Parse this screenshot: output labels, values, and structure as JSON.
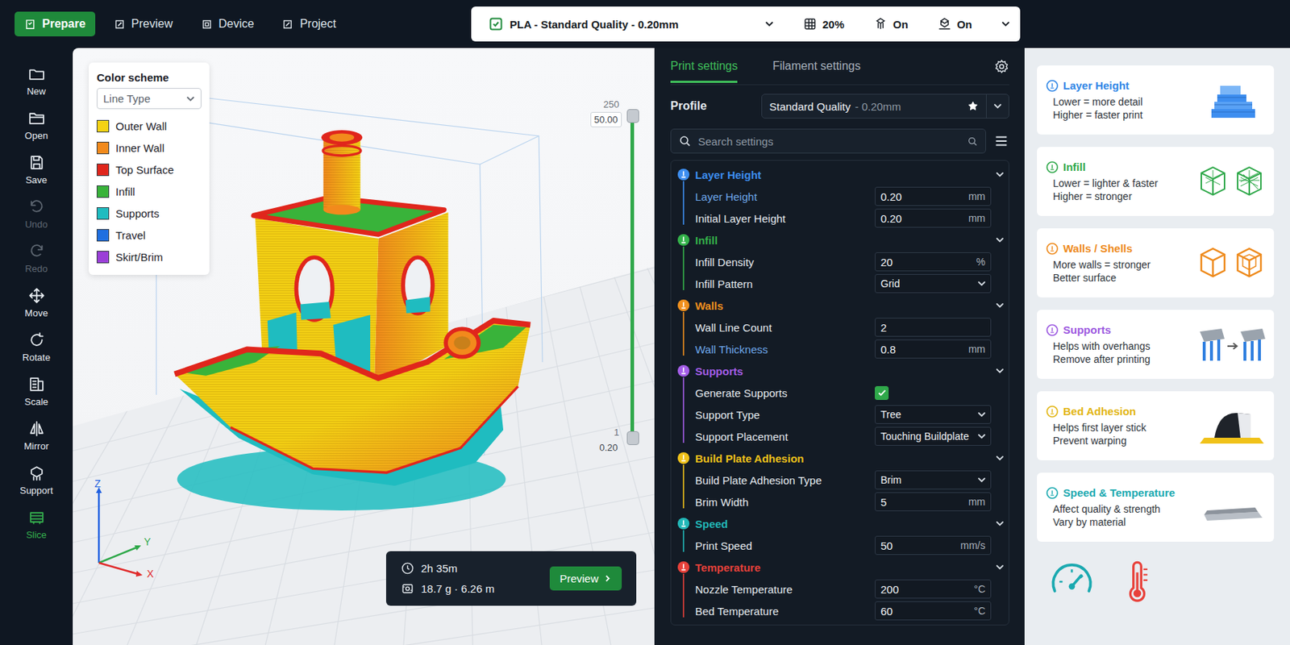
{
  "top_bar": {
    "tabs": [
      {
        "label": "Prepare",
        "selected": true
      },
      {
        "label": "Preview",
        "selected": false
      },
      {
        "label": "Device",
        "selected": false
      },
      {
        "label": "Project",
        "selected": false
      }
    ],
    "summary": {
      "profile": "PLA - Standard Quality - 0.20mm",
      "infill": "20%",
      "supports": "On",
      "adhesion": "On"
    }
  },
  "toolbar": [
    {
      "label": "New",
      "disabled": false,
      "selected": false
    },
    {
      "label": "Open",
      "disabled": false,
      "selected": false
    },
    {
      "label": "Save",
      "disabled": false,
      "selected": false
    },
    {
      "label": "Undo",
      "disabled": true,
      "selected": false
    },
    {
      "label": "Redo",
      "disabled": true,
      "selected": false
    },
    {
      "label": "Move",
      "disabled": false,
      "selected": false
    },
    {
      "label": "Rotate",
      "disabled": false,
      "selected": false
    },
    {
      "label": "Scale",
      "disabled": false,
      "selected": false
    },
    {
      "label": "Mirror",
      "disabled": false,
      "selected": false
    },
    {
      "label": "Support",
      "disabled": false,
      "selected": false
    },
    {
      "label": "Slice",
      "disabled": false,
      "selected": true
    }
  ],
  "viewport": {
    "legend": {
      "title": "Color scheme",
      "select": "Line Type",
      "items": [
        {
          "label": "Outer Wall",
          "color": "#f5d214"
        },
        {
          "label": "Inner Wall",
          "color": "#f28a1c"
        },
        {
          "label": "Top Surface",
          "color": "#e0261c"
        },
        {
          "label": "Infill",
          "color": "#39b33a"
        },
        {
          "label": "Supports",
          "color": "#1fbcc0"
        },
        {
          "label": "Travel",
          "color": "#1f6fe0"
        },
        {
          "label": "Skirt/Brim",
          "color": "#9b3fd8"
        }
      ]
    },
    "layer_slider": {
      "top_layer": "250",
      "top_height": "50.00",
      "bottom_layer": "1",
      "bottom_height": "0.20",
      "level": 1
    },
    "axes": [
      "X",
      "Y",
      "Z"
    ],
    "estimate": {
      "time": "2h 35m",
      "material": "18.7 g · 6.26 m",
      "button": "Preview"
    }
  },
  "settings": {
    "tabs": [
      {
        "label": "Print settings",
        "selected": true
      },
      {
        "label": "Filament settings",
        "selected": false
      }
    ],
    "profile": {
      "label": "Profile",
      "name": "Standard Quality",
      "detail": "- 0.20mm",
      "favorite": true
    },
    "search": {
      "placeholder": "Search settings"
    },
    "sections": [
      {
        "title": "Layer Height",
        "color": "#3d8ef0",
        "expanded": true,
        "rows": [
          {
            "kind": "number",
            "label": "Layer Height",
            "value": "0.20",
            "unit": "mm",
            "modified": true
          },
          {
            "kind": "number",
            "label": "Initial Layer Height",
            "value": "0.20",
            "unit": "mm",
            "modified": false
          }
        ]
      },
      {
        "title": "Infill",
        "color": "#34b24a",
        "expanded": true,
        "rows": [
          {
            "kind": "number",
            "label": "Infill Density",
            "value": "20",
            "unit": "%",
            "modified": false
          },
          {
            "kind": "select",
            "label": "Infill Pattern",
            "value": "Grid",
            "modified": false
          }
        ]
      },
      {
        "title": "Walls",
        "color": "#f0901e",
        "expanded": true,
        "rows": [
          {
            "kind": "number",
            "label": "Wall Line Count",
            "value": "2",
            "modified": false
          },
          {
            "kind": "number",
            "label": "Wall Thickness",
            "value": "0.8",
            "unit": "mm",
            "modified": true
          }
        ]
      },
      {
        "title": "Supports",
        "color": "#a55ee8",
        "expanded": true,
        "rows": [
          {
            "kind": "checkbox",
            "label": "Generate Supports",
            "checked": true,
            "modified": false
          },
          {
            "kind": "select",
            "label": "Support Type",
            "value": "Tree",
            "modified": false
          },
          {
            "kind": "select",
            "label": "Support Placement",
            "value": "Touching Buildplate",
            "modified": false
          }
        ]
      },
      {
        "title": "Build Plate Adhesion",
        "color": "#f0c21a",
        "expanded": true,
        "rows": [
          {
            "kind": "select",
            "label": "Build Plate Adhesion Type",
            "value": "Brim",
            "modified": false
          },
          {
            "kind": "number",
            "label": "Brim Width",
            "value": "5",
            "unit": "mm",
            "modified": false
          }
        ]
      },
      {
        "title": "Speed",
        "color": "#22b8b8",
        "expanded": true,
        "rows": [
          {
            "kind": "number",
            "label": "Print Speed",
            "value": "50",
            "unit": "mm/s",
            "modified": false
          }
        ]
      },
      {
        "title": "Temperature",
        "color": "#e8413a",
        "expanded": true,
        "rows": [
          {
            "kind": "number",
            "label": "Nozzle Temperature",
            "value": "200",
            "unit": "°C",
            "modified": false
          },
          {
            "kind": "number",
            "label": "Bed Temperature",
            "value": "60",
            "unit": "°C",
            "modified": false
          }
        ]
      }
    ]
  },
  "help": {
    "cards": [
      {
        "title": "Layer Height",
        "lines": [
          "Lower = more detail",
          "Higher = faster print"
        ],
        "color": "#2f86e6"
      },
      {
        "title": "Infill",
        "lines": [
          "Lower = lighter & faster",
          "Higher = stronger"
        ],
        "color": "#2fa84a"
      },
      {
        "title": "Walls / Shells",
        "lines": [
          "More walls = stronger",
          "Better surface"
        ],
        "color": "#ee8a1c"
      },
      {
        "title": "Supports",
        "lines": [
          "Helps with overhangs",
          "Remove after printing"
        ],
        "color": "#9b57e0"
      },
      {
        "title": "Bed Adhesion",
        "lines": [
          "Helps first layer stick",
          "Prevent warping"
        ],
        "color": "#e2b512"
      },
      {
        "title": "Speed & Temperature",
        "lines": [
          "Affect quality & strength",
          "Vary by material"
        ],
        "color": "#1aa9b0"
      }
    ]
  }
}
